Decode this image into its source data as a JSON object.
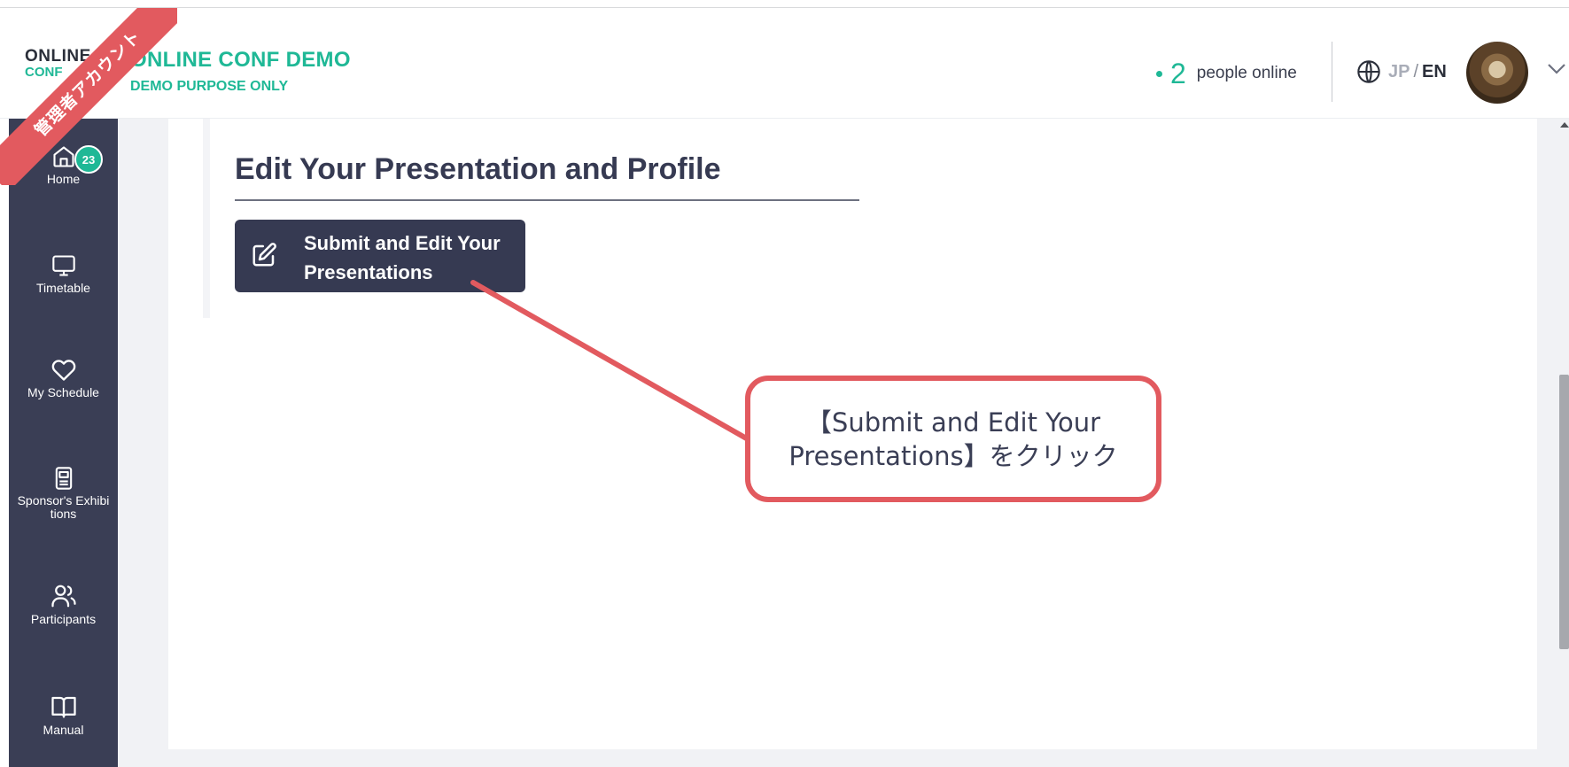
{
  "header": {
    "logo_line1": "ONLINE",
    "logo_line2": "CONF",
    "conference_title": "ONLINE CONF DEMO",
    "conference_subtitle": "DEMO PURPOSE ONLY",
    "online_count": "2",
    "online_label": "people online",
    "lang_jp": "JP",
    "lang_sep": "/",
    "lang_en": "EN"
  },
  "ribbon": {
    "text": "管理者アカウント",
    "color": "#e25a5f"
  },
  "sidebar": {
    "items": [
      {
        "label": "Home",
        "icon": "home-icon",
        "badge": "23"
      },
      {
        "label": "Timetable",
        "icon": "monitor-icon"
      },
      {
        "label": "My Schedule",
        "icon": "heart-icon"
      },
      {
        "label": "Sponsor's Exhibitions",
        "label_line1": "Sponsor's Exhibi",
        "label_line2": "tions",
        "icon": "booklet-icon"
      },
      {
        "label": "Participants",
        "icon": "users-icon"
      },
      {
        "label": "Manual",
        "icon": "book-icon"
      }
    ]
  },
  "main": {
    "section_title": "Edit Your Presentation and Profile",
    "submit_button_line1": "Submit and Edit Your",
    "submit_button_line2": "Presentations"
  },
  "annotation": {
    "line1": "【Submit and Edit Your",
    "line2": "Presentations】をクリック"
  },
  "colors": {
    "accent": "#1fb896",
    "sidebar_bg": "#3a3e55",
    "button_bg": "#363a52",
    "annotation": "#e25a5f"
  }
}
